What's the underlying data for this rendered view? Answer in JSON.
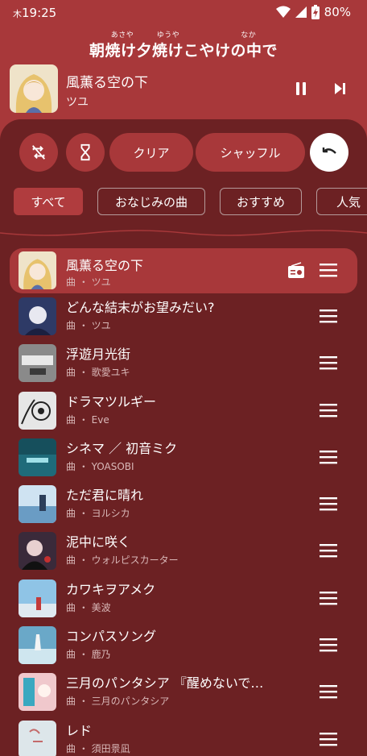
{
  "status": {
    "time": "19:25",
    "day": "木",
    "battery": "80%"
  },
  "lyric": {
    "ruby": "あさや　　　ゆうや　　　　　　　　なか",
    "line": "朝焼け夕焼けこやけの中で"
  },
  "now_playing": {
    "title": "風薫る空の下",
    "artist": "ツユ"
  },
  "controls": {
    "clear": "クリア",
    "shuffle": "シャッフル"
  },
  "chips": [
    "すべて",
    "おなじみの曲",
    "おすすめ",
    "人気"
  ],
  "queue": [
    {
      "title": "風薫る空の下",
      "subtitle": "曲 ・ ツユ",
      "color": "#d9b98a"
    },
    {
      "title": "どんな結末がお望みだい?",
      "subtitle": "曲 ・ ツユ",
      "color": "#3a4a7a"
    },
    {
      "title": "浮遊月光街",
      "subtitle": "曲 ・ 歌愛ユキ",
      "color": "#8a8a8a"
    },
    {
      "title": "ドラマツルギー",
      "subtitle": "曲 ・ Eve",
      "color": "#e0e0e0"
    },
    {
      "title": "シネマ ／ 初音ミク",
      "subtitle": "曲 ・ YOASOBI",
      "color": "#1f6b7a"
    },
    {
      "title": "ただ君に晴れ",
      "subtitle": "曲 ・ ヨルシカ",
      "color": "#7fb0d8"
    },
    {
      "title": "泥中に咲く",
      "subtitle": "曲 ・ ウォルピスカーター",
      "color": "#3a2a3a"
    },
    {
      "title": "カワキヲアメク",
      "subtitle": "曲 ・ 美波",
      "color": "#8fc4e6"
    },
    {
      "title": "コンパスソング",
      "subtitle": "曲 ・ 鹿乃",
      "color": "#6aa8c8"
    },
    {
      "title": "三月のパンタシア 『醒めないで…",
      "subtitle": "曲 ・ 三月のパンタシア",
      "color": "#e8a0a8"
    },
    {
      "title": "レド",
      "subtitle": "曲 ・ 須田景凪",
      "color": "#d8e2e6"
    }
  ]
}
